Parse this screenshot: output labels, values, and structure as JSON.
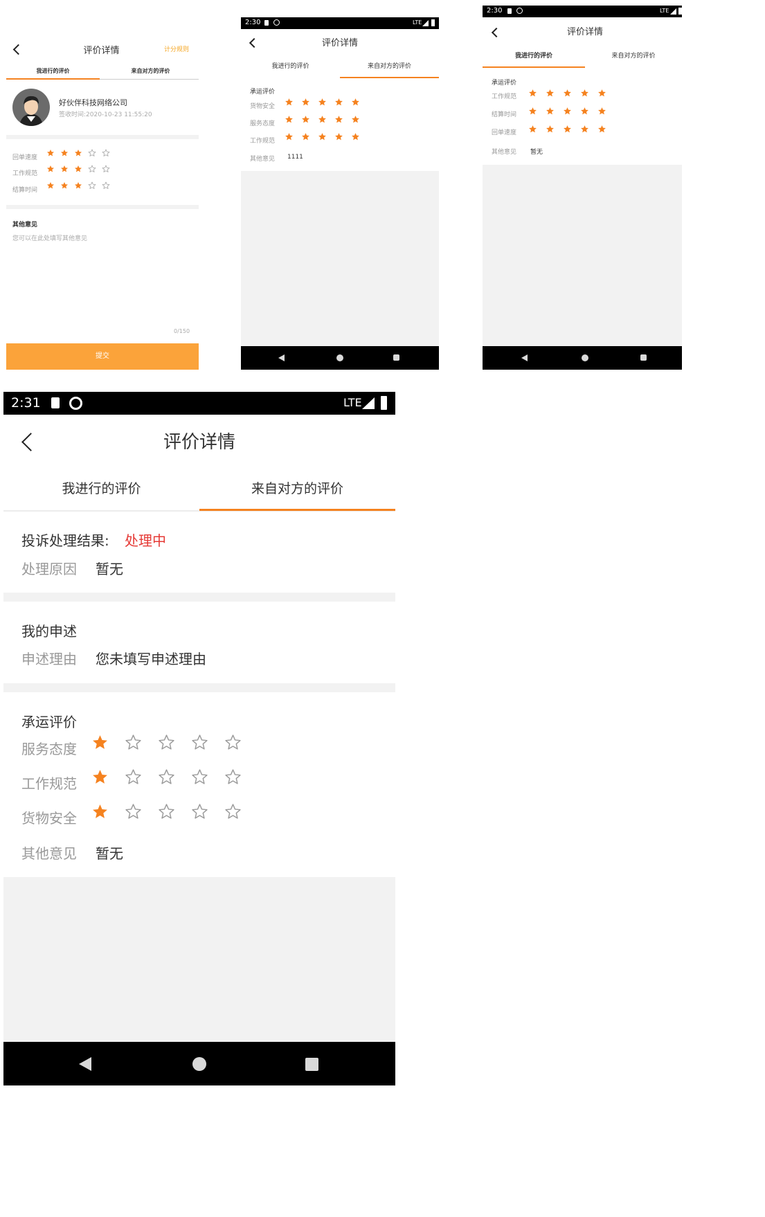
{
  "colors": {
    "accent": "#f5821f",
    "alert": "#e53935",
    "submit": "#fba33a"
  },
  "icons": {
    "back": "chevron-left-icon",
    "star_filled": "star-filled-icon",
    "star_empty": "star-outline-icon"
  },
  "s1": {
    "title": "评价详情",
    "rule_link": "计分规则",
    "tabs": [
      "我进行的评价",
      "来自对方的评价"
    ],
    "company": "好伙伴科技网络公司",
    "sign_time": "签收时间:2020-10-23 11:55:20",
    "ratings": [
      {
        "label": "回单速度",
        "score": 3
      },
      {
        "label": "工作规范",
        "score": 3
      },
      {
        "label": "结算时间",
        "score": 3
      }
    ],
    "other_title": "其他意见",
    "other_placeholder": "您可以在此处填写其他意见",
    "counter": "0/150",
    "submit": "提交"
  },
  "s2": {
    "time": "2:30",
    "network": "LTE",
    "title": "评价详情",
    "tabs": [
      "我进行的评价",
      "来自对方的评价"
    ],
    "section": "承运评价",
    "ratings": [
      {
        "label": "货物安全",
        "score": 5
      },
      {
        "label": "服务态度",
        "score": 5
      },
      {
        "label": "工作规范",
        "score": 5
      }
    ],
    "other_label": "其他意见",
    "other_value": "1111"
  },
  "s3": {
    "time": "2:30",
    "network": "LTE",
    "title": "评价详情",
    "tabs": [
      "我进行的评价",
      "来自对方的评价"
    ],
    "section": "承运评价",
    "ratings": [
      {
        "label": "工作规范",
        "score": 5
      },
      {
        "label": "结算时间",
        "score": 5
      },
      {
        "label": "回单速度",
        "score": 5
      }
    ],
    "other_label": "其他意见",
    "other_value": "暂无"
  },
  "s4": {
    "time": "2:31",
    "network": "LTE",
    "title": "评价详情",
    "tabs": [
      "我进行的评价",
      "来自对方的评价"
    ],
    "complaint_label": "投诉处理结果:",
    "complaint_status": "处理中",
    "reason_label": "处理原因",
    "reason_value": "暂无",
    "appeal_title": "我的申述",
    "appeal_label": "申述理由",
    "appeal_value": "您未填写申述理由",
    "section": "承运评价",
    "ratings": [
      {
        "label": "服务态度",
        "score": 1
      },
      {
        "label": "工作规范",
        "score": 1
      },
      {
        "label": "货物安全",
        "score": 1
      }
    ],
    "other_label": "其他意见",
    "other_value": "暂无"
  }
}
